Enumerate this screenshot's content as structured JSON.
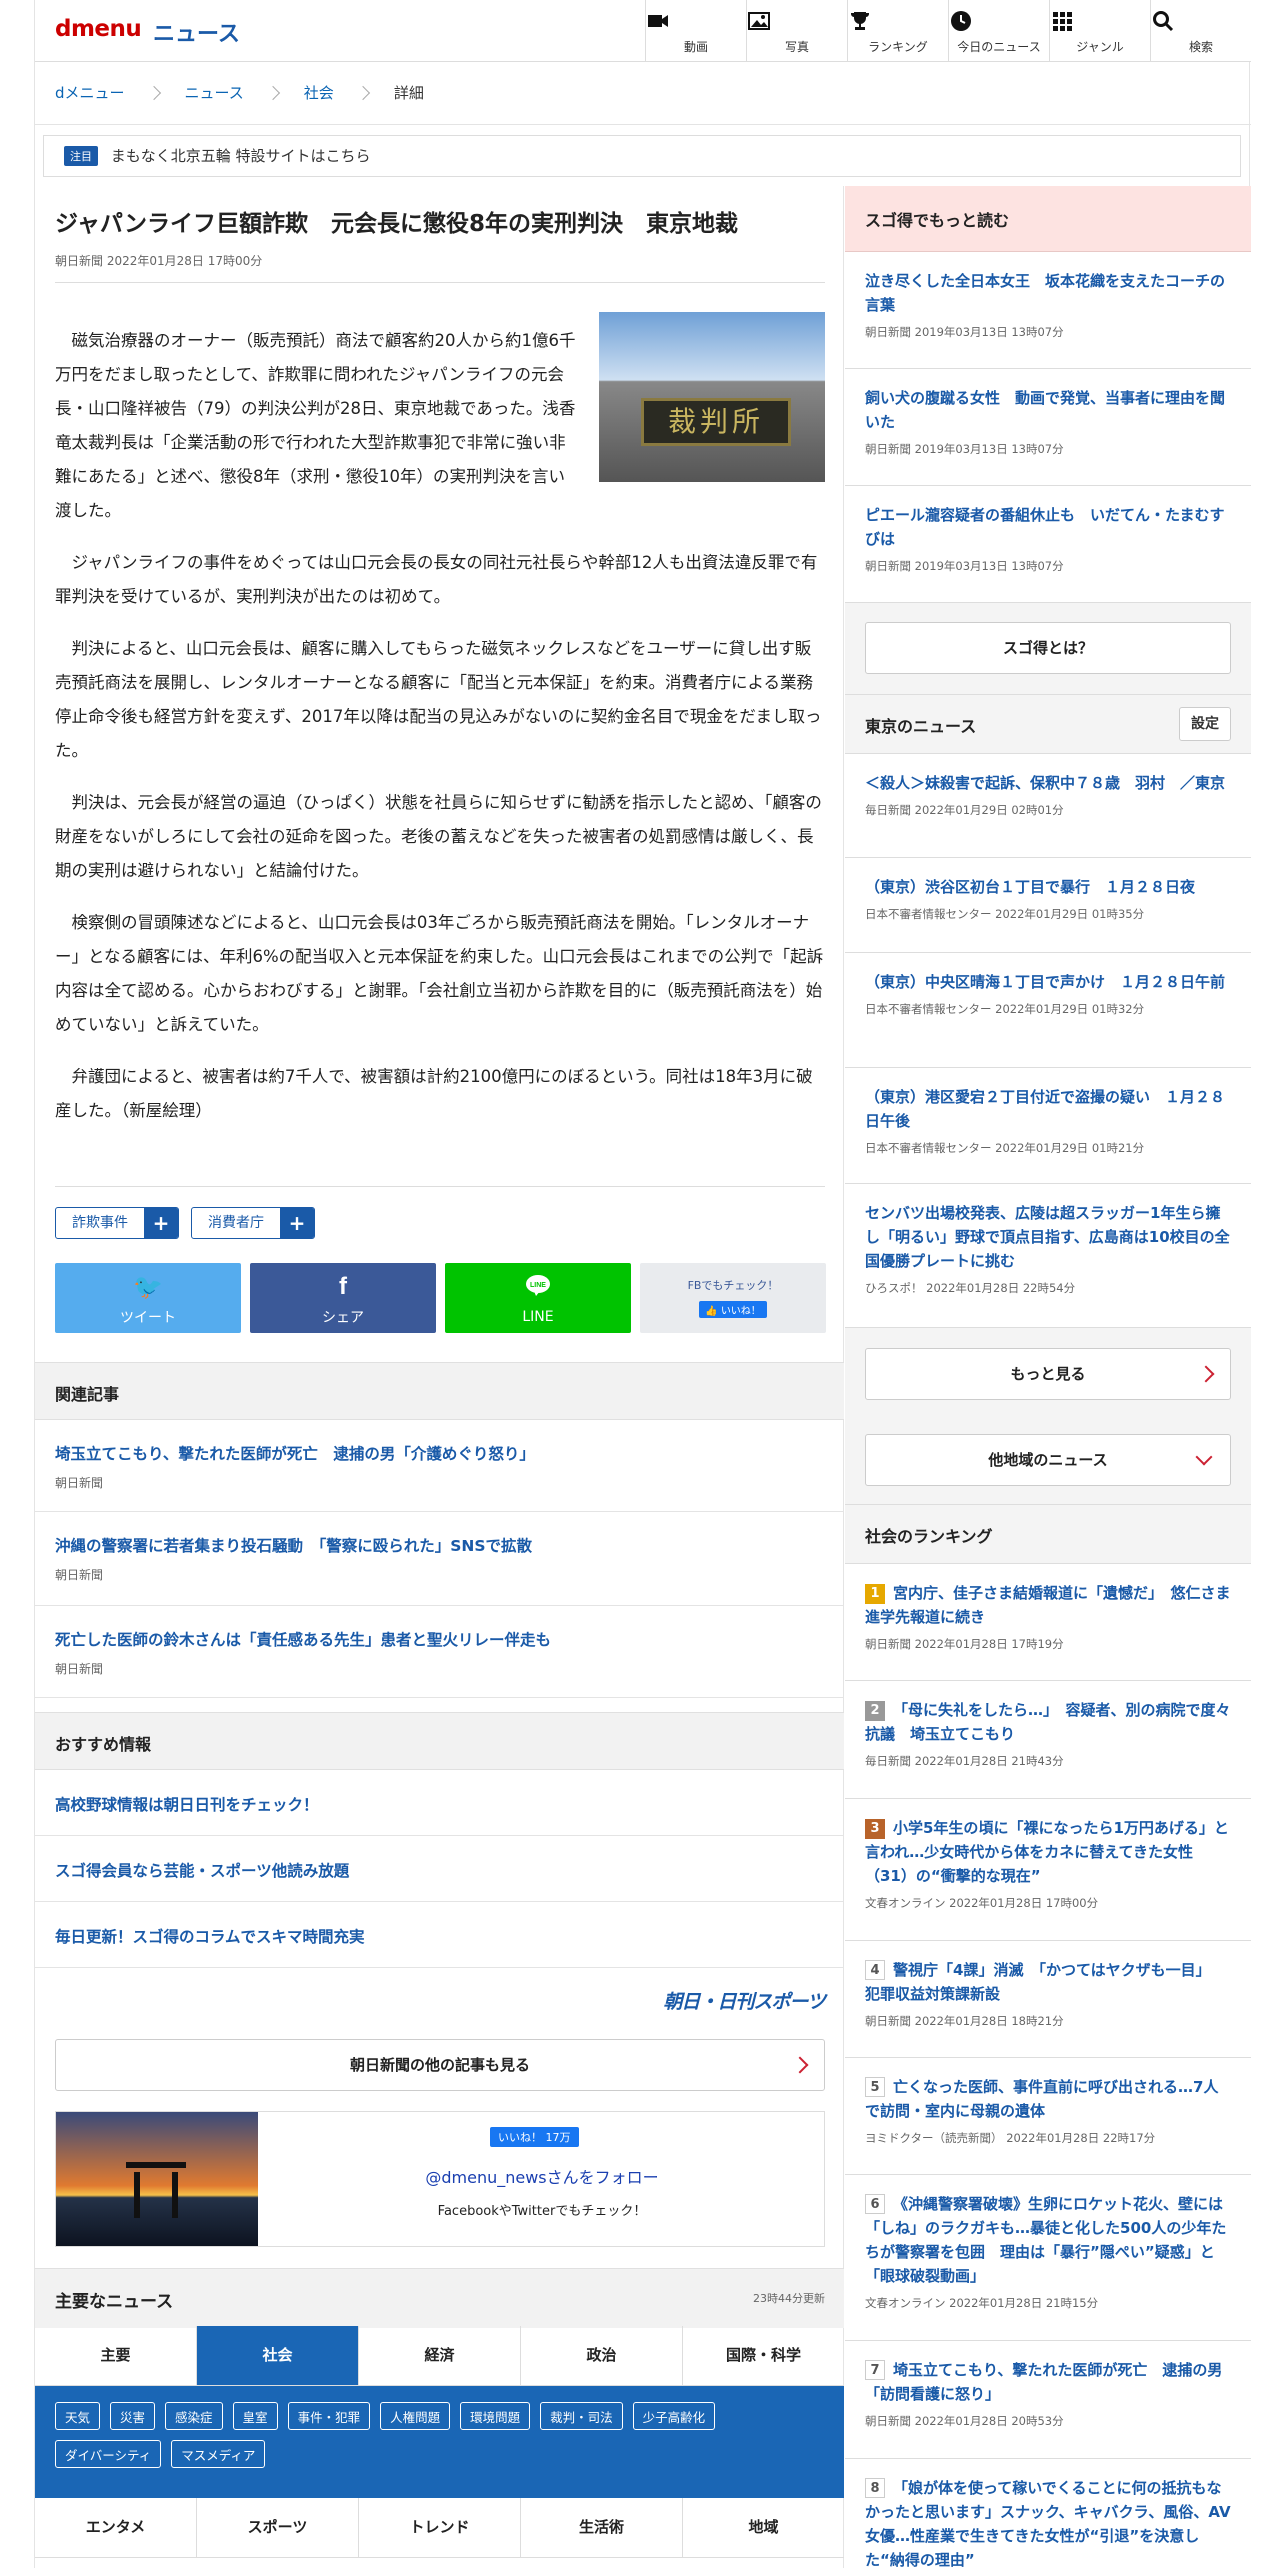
{
  "header": {
    "logo": "dmenu",
    "section": "ニュース",
    "nav": [
      {
        "icon": "video-icon",
        "label": "動画"
      },
      {
        "icon": "photo-icon",
        "label": "写真"
      },
      {
        "icon": "trophy-icon",
        "label": "ランキング"
      },
      {
        "icon": "clock-icon",
        "label": "今日のニュース"
      },
      {
        "icon": "grid-icon",
        "label": "ジャンル"
      },
      {
        "icon": "search-icon",
        "label": "検索"
      }
    ]
  },
  "breadcrumb": [
    "dメニュー",
    "ニュース",
    "社会",
    "詳細"
  ],
  "notice": {
    "badge": "注目",
    "text": "まもなく北京五輪 特設サイトはこちら"
  },
  "article": {
    "title": "ジャパンライフ巨額詐欺　元会長に懲役8年の実刑判決　東京地裁",
    "date": "朝日新聞 2022年01月28日 17時00分",
    "photo_label": "裁判所",
    "paragraphs": [
      "磁気治療器のオーナー（販売預託）商法で顧客約20人から約1億6千万円をだまし取ったとして、詐欺罪に問われたジャパンライフの元会長・山口隆祥被告（79）の判決公判が28日、東京地裁であった。浅香竜太裁判長は「企業活動の形で行われた大型詐欺事犯で非常に強い非難にあたる」と述べ、懲役8年（求刑・懲役10年）の実刑判決を言い渡した。",
      "ジャパンライフの事件をめぐっては山口元会長の長女の同社元社長らや幹部12人も出資法違反罪で有罪判決を受けているが、実刑判決が出たのは初めて。",
      "判決によると、山口元会長は、顧客に購入してもらった磁気ネックレスなどをユーザーに貸し出す販売預託商法を展開し、レンタルオーナーとなる顧客に「配当と元本保証」を約束。消費者庁による業務停止命令後も経営方針を変えず、2017年以降は配当の見込みがないのに契約金名目で現金をだまし取った。",
      "判決は、元会長が経営の逼迫（ひっぱく）状態を社員らに知らせずに勧誘を指示したと認め、「顧客の財産をないがしろにして会社の延命を図った。老後の蓄えなどを失った被害者の処罰感情は厳しく、長期の実刑は避けられない」と結論付けた。",
      "検察側の冒頭陳述などによると、山口元会長は03年ごろから販売預託商法を開始。「レンタルオーナー」となる顧客には、年利6%の配当収入と元本保証を約束した。山口元会長はこれまでの公判で「起訴内容は全て認める。心からおわびする」と謝罪。「会社創立当初から詐欺を目的に（販売預託商法を）始めていない」と訴えていた。",
      "弁護団によると、被害者は約7千人で、被害額は計約2100億円にのぼるという。同社は18年3月に破産した。（新屋絵理）"
    ],
    "tags": [
      "詐欺事件",
      "消費者庁"
    ],
    "share": [
      {
        "label": "ツイート",
        "color": "#55acee",
        "icon": "twitter-icon"
      },
      {
        "label": "シェア",
        "color": "#3b5998",
        "icon": "facebook-icon"
      },
      {
        "label": "LINE",
        "color": "#00c300",
        "icon": "line-icon"
      }
    ],
    "fb_check": "FBでもチェック！",
    "fb_like": "いいね！"
  },
  "related": {
    "heading": "関連記事",
    "items": [
      {
        "title": "埼玉立てこもり、撃たれた医師が死亡　逮捕の男「介護めぐり怒り」",
        "source": "朝日新聞"
      },
      {
        "title": "沖縄の警察署に若者集まり投石騒動　「警察に殴られた」SNSで拡散",
        "source": "朝日新聞"
      },
      {
        "title": "死亡した医師の鈴木さんは「責任感ある先生」患者と聖火リレー伴走も",
        "source": "朝日新聞"
      }
    ]
  },
  "recommend": {
    "heading": "おすすめ情報",
    "items": [
      "高校野球情報は朝日日刊をチェック！",
      "スゴ得会員なら芸能・スポーツ他読み放題",
      "毎日更新！スゴ得のコラムでスキマ時間充実"
    ]
  },
  "asahi_logo": "朝日・日刊スポーツ",
  "more_button": "朝日新聞の他の記事も見る",
  "follow": {
    "like": "いいね！ 17万",
    "account": "@dmenu_newsさんをフォロー",
    "sub": "FacebookやTwitterでもチェック！"
  },
  "main_news": {
    "heading": "主要なニュース",
    "updated": "23時44分更新",
    "tabs": [
      "主要",
      "社会",
      "経済",
      "政治",
      "国際・科学"
    ],
    "active_tab": "社会",
    "subtags": [
      "天気",
      "災害",
      "感染症",
      "皇室",
      "事件・犯罪",
      "人権問題",
      "環境問題",
      "裁判・司法",
      "少子高齢化",
      "ダイバーシティ",
      "マスメディア"
    ],
    "tabs2": [
      "エンタメ",
      "スポーツ",
      "トレンド",
      "生活術",
      "地域"
    ]
  },
  "side": {
    "sugotoku": {
      "heading": "スゴ得でもっと読む",
      "items": [
        {
          "title": "泣き尽くした全日本女王　坂本花織を支えたコーチの言葉",
          "source": "朝日新聞 2019年03月13日 13時07分"
        },
        {
          "title": "飼い犬の腹蹴る女性　動画で発覚、当事者に理由を聞いた",
          "source": "朝日新聞 2019年03月13日 13時07分"
        },
        {
          "title": "ピエール瀧容疑者の番組休止も　いだてん・たまむすびは",
          "source": "朝日新聞 2019年03月13日 13時07分"
        }
      ],
      "button": "スゴ得とは？"
    },
    "local": {
      "heading": "東京のニュース",
      "setting": "設定",
      "items": [
        {
          "title": "＜殺人＞妹殺害で起訴、保釈中７８歳　羽村　／東京",
          "source": "毎日新聞 2022年01月29日 02時01分"
        },
        {
          "title": "（東京）渋谷区初台１丁目で暴行　１月２８日夜",
          "source": "日本不審者情報センター 2022年01月29日 01時35分"
        },
        {
          "title": "（東京）中央区晴海１丁目で声かけ　１月２８日午前",
          "source": "日本不審者情報センター 2022年01月29日 01時32分"
        },
        {
          "title": "（東京）港区愛宕２丁目付近で盗撮の疑い　１月２８日午後",
          "source": "日本不審者情報センター 2022年01月29日 01時21分"
        },
        {
          "title": "センバツ出場校発表、広陵は超スラッガー1年生ら擁し「明るい」野球で頂点目指す、広島商は10校目の全国優勝プレートに挑む",
          "source": "ひろスポ！ 2022年01月28日 22時54分"
        }
      ],
      "more": "もっと見る",
      "other": "他地域のニュース"
    },
    "ranking": {
      "heading": "社会のランキング",
      "items": [
        {
          "rank": "1",
          "color": "#e6a800",
          "title": "宮内庁、佳子さま結婚報道に「遺憾だ」　悠仁さま進学先報道に続き",
          "source": "朝日新聞 2022年01月28日 17時19分"
        },
        {
          "rank": "2",
          "color": "#999999",
          "title": "「母に失礼をしたら…」　容疑者、別の病院で度々抗議　埼玉立てこもり",
          "source": "毎日新聞 2022年01月28日 21時43分"
        },
        {
          "rank": "3",
          "color": "#b8632a",
          "title": "小学5年生の頃に「裸になったら1万円あげる」と言われ…少女時代から体をカネに替えてきた女性（31）の“衝撃的な現在”",
          "source": "文春オンライン 2022年01月28日 17時00分"
        },
        {
          "rank": "4",
          "color": "#666666",
          "title": "警視庁「4課」消滅　「かつてはヤクザも一目」　犯罪収益対策課新設",
          "source": "朝日新聞 2022年01月28日 18時21分"
        },
        {
          "rank": "5",
          "color": "#666666",
          "title": "亡くなった医師、事件直前に呼び出される…7人で訪問・室内に母親の遺体",
          "source": "ヨミドクター（読売新聞） 2022年01月28日 22時17分"
        },
        {
          "rank": "6",
          "color": "#666666",
          "title": "《沖縄警察署破壊》生卵にロケット花火、壁には「しね」のラクガキも…暴徒と化した500人の少年たちが警察署を包囲　理由は「暴行”隠ぺい”疑惑」と「眼球破裂動画」",
          "source": "文春オンライン 2022年01月28日 21時15分"
        },
        {
          "rank": "7",
          "color": "#666666",
          "title": "埼玉立てこもり、撃たれた医師が死亡　逮捕の男「訪問看護に怒り」",
          "source": "朝日新聞 2022年01月28日 20時53分"
        },
        {
          "rank": "8",
          "color": "#666666",
          "title": "「娘が体を使って稼いでくることに何の抵抗もなかったと思います」スナック、キャバクラ、風俗、AV女優…性産業で生きてきた女性が“引退”を決意した“納得の理由”",
          "source": ""
        }
      ]
    }
  }
}
